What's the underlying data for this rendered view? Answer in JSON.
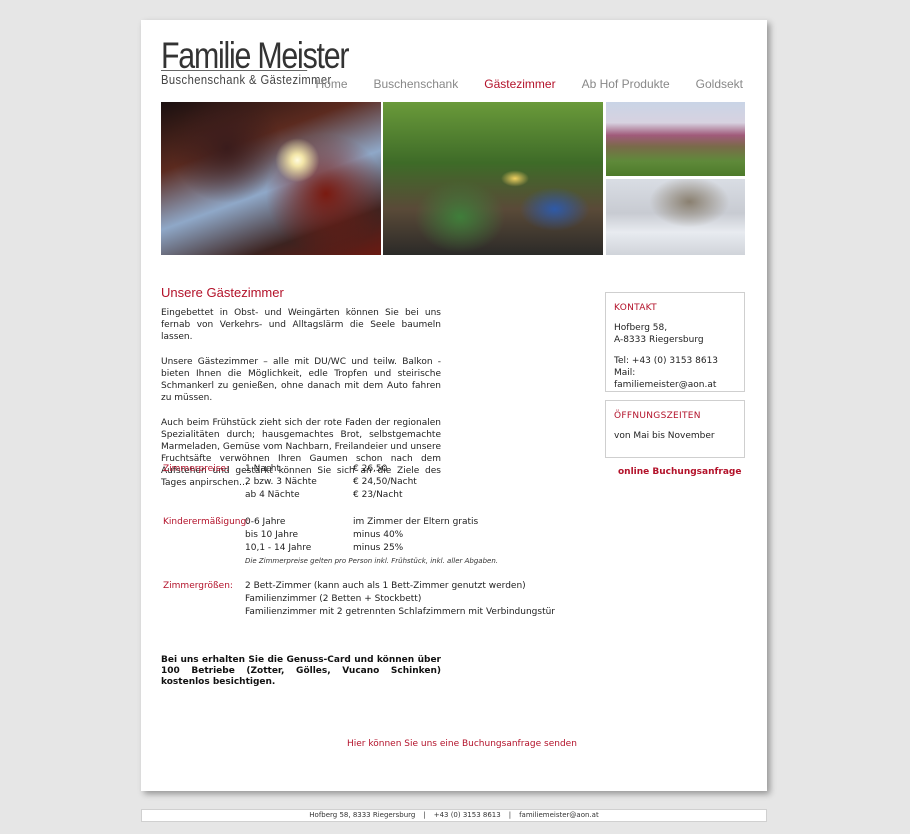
{
  "logo": {
    "title": "Familie Meister",
    "subtitle": "Buschenschank & Gästezimmer"
  },
  "nav": [
    {
      "label": "Home",
      "active": false
    },
    {
      "label": "Buschenschank",
      "active": false
    },
    {
      "label": "Gästezimmer",
      "active": true
    },
    {
      "label": "Ab Hof Produkte",
      "active": false
    },
    {
      "label": "Goldsekt",
      "active": false
    }
  ],
  "main": {
    "heading": "Unsere Gästezimmer",
    "paragraphs": [
      "Eingebettet in Obst- und Weingärten können Sie bei uns fernab von Verkehrs- und Alltagslärm die Seele baumeln lassen.",
      "Unsere Gästezimmer – alle mit DU/WC und teilw. Balkon - bieten Ihnen die Möglichkeit, edle Tropfen und steirische Schmankerl zu genießen, ohne danach mit dem Auto fahren zu müssen.",
      "Auch beim Frühstück zieht sich der rote Faden der regionalen Spezialitäten durch; hausgemachtes Brot, selbstgemachte Marmeladen, Gemüse vom Nachbarn, Freilandeier und unsere Fruchtsäfte verwöhnen Ihren Gaumen schon nach dem Aufstehen und gestärkt können Sie sich an die Ziele des Tages anpirschen…"
    ],
    "prices": {
      "label": "Zimmerpreise:",
      "rows": [
        {
          "desc": "1 Nacht",
          "price": "€ 26,50"
        },
        {
          "desc": "2 bzw. 3 Nächte",
          "price": "€ 24,50/Nacht"
        },
        {
          "desc": "ab 4 Nächte",
          "price": "€ 23/Nacht"
        }
      ]
    },
    "discount": {
      "label": "Kinderermäßigung:",
      "rows": [
        {
          "age": "0-6 Jahre",
          "value": "im Zimmer der Eltern gratis"
        },
        {
          "age": "bis 10 Jahre",
          "value": "minus 40%"
        },
        {
          "age": "10,1 - 14 Jahre",
          "value": "minus 25%"
        }
      ],
      "note": "Die Zimmerpreise gelten pro Person inkl. Frühstück, inkl. aller Abgaben."
    },
    "sizes": {
      "label": "Zimmergrößen:",
      "rows": [
        "2 Bett-Zimmer (kann auch als 1 Bett-Zimmer genutzt werden)",
        "Familienzimmer (2 Betten + Stockbett)",
        "Familienzimmer mit 2 getrennten Schlafzimmern mit Verbindungstür"
      ]
    },
    "genuss": "Bei uns erhalten Sie die Genuss-Card und können über 100 Betriebe (Zotter, Gölles, Vucano Schinken) kostenlos besichtigen.",
    "booking_bottom": "Hier können Sie uns eine Buchungsanfrage senden"
  },
  "sidebar": {
    "kontakt": {
      "title": "KONTAKT",
      "street": "Hofberg 58,",
      "city": "A-8333 Riegersburg",
      "tel": "Tel: +43 (0) 3153 8613",
      "mail": "Mail: familiemeister@aon.at"
    },
    "hours": {
      "title": "ÖFFNUNGSZEITEN",
      "text": "von Mai bis November"
    },
    "booking_link": "online Buchungsanfrage"
  },
  "footer": {
    "address": "Hofberg 58, 8333 Riegersburg",
    "phone": "+43 (0) 3153 8613",
    "email": "familiemeister@aon.at",
    "separator": "|"
  },
  "colors": {
    "accent": "#b3122a",
    "page_bg": "#e6e6e6",
    "card_bg": "#ffffff"
  }
}
